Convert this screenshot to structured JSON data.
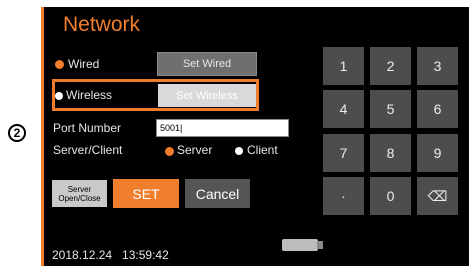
{
  "annotation": {
    "marker": "2"
  },
  "header": {
    "title": "Network"
  },
  "connection": {
    "wired_label": "Wired",
    "wired_selected": true,
    "set_wired_label": "Set Wired",
    "wireless_label": "Wireless",
    "wireless_selected": false,
    "set_wireless_label": "Set Wireless"
  },
  "port": {
    "label": "Port Number",
    "value": "5001|"
  },
  "role": {
    "label": "Server/Client",
    "server_label": "Server",
    "client_label": "Client",
    "selected": "Server"
  },
  "actions": {
    "server_open_close_line1": "Server",
    "server_open_close_line2": "Open/Close",
    "set_label": "SET",
    "cancel_label": "Cancel"
  },
  "status": {
    "datetime": "2018.12.24   13:59:42"
  },
  "keypad": {
    "keys": [
      "1",
      "2",
      "3",
      "4",
      "5",
      "6",
      "7",
      "8",
      "9",
      "·",
      "0",
      "⌫"
    ]
  },
  "colors": {
    "accent": "#f07e2c",
    "background": "#000000",
    "key": "#4d4d4d"
  }
}
